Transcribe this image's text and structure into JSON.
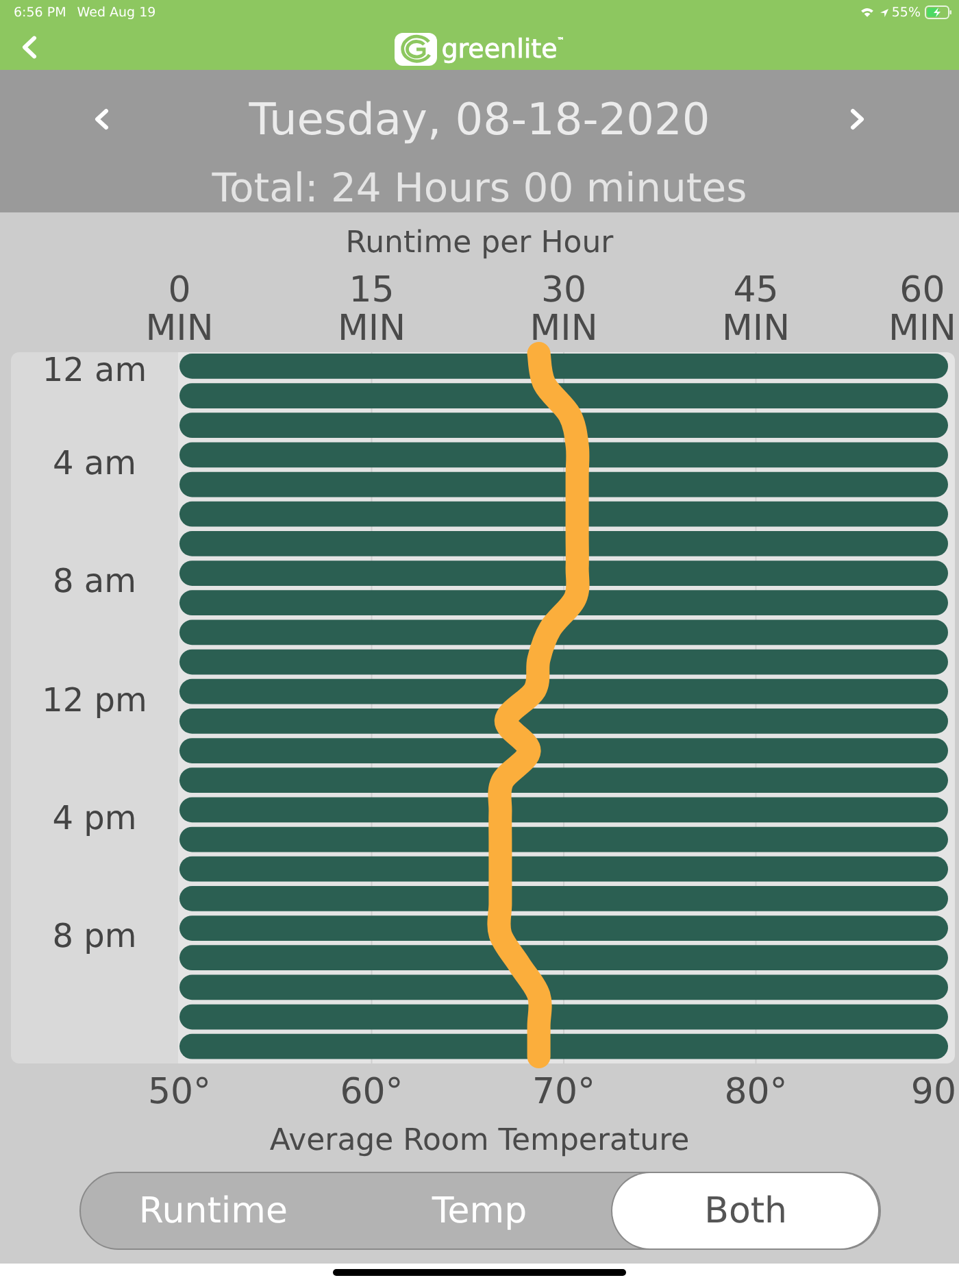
{
  "status_bar": {
    "time": "6:56 PM",
    "date": "Wed Aug 19",
    "battery": "55%"
  },
  "nav_bar": {
    "logo_text": "greenlite$^{™}$"
  },
  "date_header": {
    "date": "Tuesday, 08-18-2020",
    "total": "Total: 24 Hours 00 minutes"
  },
  "chart": {
    "hour_labels": [
      "12 am",
      "4 am",
      "8 am",
      "12 pm",
      "4 pm",
      "8 pm"
    ],
    "chart_data": {
      "type": "bar",
      "orientation": "horizontal",
      "grid": true,
      "xlabel": "Runtime per Hour",
      "xlim": [
        0,
        60
      ],
      "xticks": [
        {
          "value": 0,
          "label": "0 MIN"
        },
        {
          "value": 15,
          "label": "15 MIN"
        },
        {
          "value": 30,
          "label": "30 MIN"
        },
        {
          "value": 45,
          "label": "45 MIN"
        },
        {
          "value": 60,
          "label": "60 MIN"
        }
      ],
      "x2label": "Average Room Temperature",
      "x2lim": [
        50,
        90
      ],
      "x2ticks": [
        {
          "value": 50,
          "label": "50°"
        },
        {
          "value": 60,
          "label": "60°"
        },
        {
          "value": 70,
          "label": "70°"
        },
        {
          "value": 80,
          "label": "80°"
        },
        {
          "value": 90,
          "label": "90"
        }
      ],
      "series": [
        {
          "type": "bar",
          "color": "#2b5f52",
          "values": [
            60,
            60,
            60,
            60,
            60,
            60,
            60,
            60,
            60,
            60,
            60,
            60,
            60,
            60,
            60,
            60,
            60,
            60,
            60,
            60,
            60,
            60,
            60,
            60
          ]
        },
        {
          "type": "line",
          "axis": "x2",
          "color": "#fbae3c",
          "values": [
            68.7,
            69.0,
            70.3,
            70.7,
            70.7,
            70.7,
            70.7,
            70.7,
            70.6,
            69.3,
            68.7,
            68.5,
            67.0,
            68.2,
            66.8,
            66.7,
            66.7,
            66.7,
            66.7,
            66.7,
            67.7,
            68.7,
            68.7,
            68.7
          ]
        }
      ]
    }
  },
  "view_toggle": [
    {
      "label": "Runtime",
      "selected": false
    },
    {
      "label": "Temp",
      "selected": false
    },
    {
      "label": "Both",
      "selected": true
    }
  ]
}
